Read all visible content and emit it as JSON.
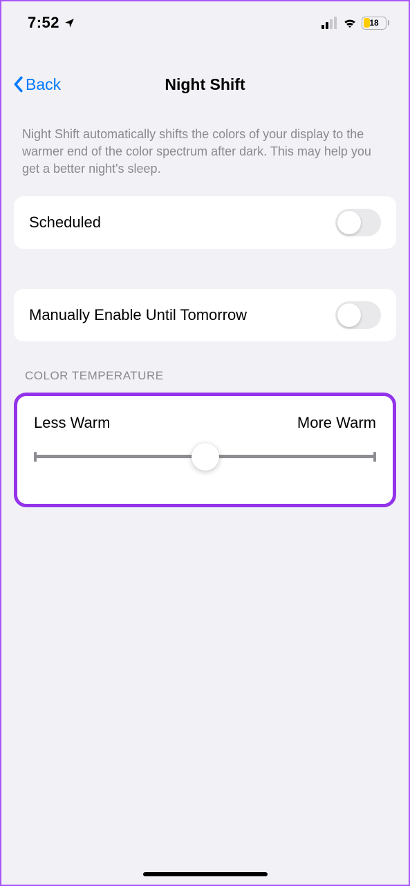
{
  "status": {
    "time": "7:52",
    "battery_percent": "18"
  },
  "nav": {
    "back_label": "Back",
    "title": "Night Shift"
  },
  "description": "Night Shift automatically shifts the colors of your display to the warmer end of the color spectrum after dark. This may help you get a better night's sleep.",
  "rows": {
    "scheduled_label": "Scheduled",
    "manual_label": "Manually Enable Until Tomorrow"
  },
  "color_temp": {
    "header": "COLOR TEMPERATURE",
    "less_label": "Less Warm",
    "more_label": "More Warm"
  }
}
